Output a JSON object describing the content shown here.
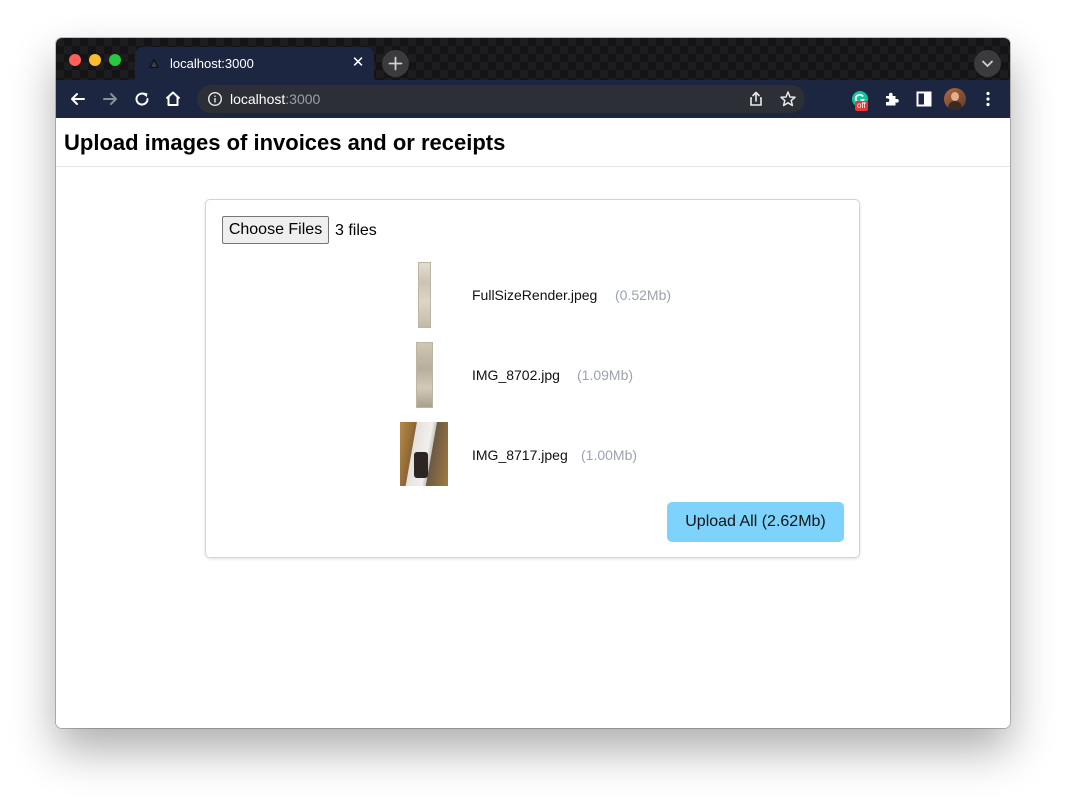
{
  "browser": {
    "tab_title": "localhost:3000",
    "tab_close": "✕",
    "address_host": "localhost",
    "address_port": ":3000",
    "extension_badge": "off"
  },
  "page": {
    "title": "Upload images of invoices and or receipts",
    "file_input": {
      "button_label": "Choose Files",
      "status": "3 files"
    },
    "files": [
      {
        "name": "FullSizeRender.jpeg",
        "size": "(0.52Mb)"
      },
      {
        "name": "IMG_8702.jpg",
        "size": "(1.09Mb)"
      },
      {
        "name": "IMG_8717.jpeg",
        "size": "(1.00Mb)"
      }
    ],
    "upload_button": "Upload All (2.62Mb)"
  },
  "colors": {
    "upload_button": "#7dd3fc",
    "toolbar": "#1c2640",
    "file_size_text": "#9ca3af"
  }
}
